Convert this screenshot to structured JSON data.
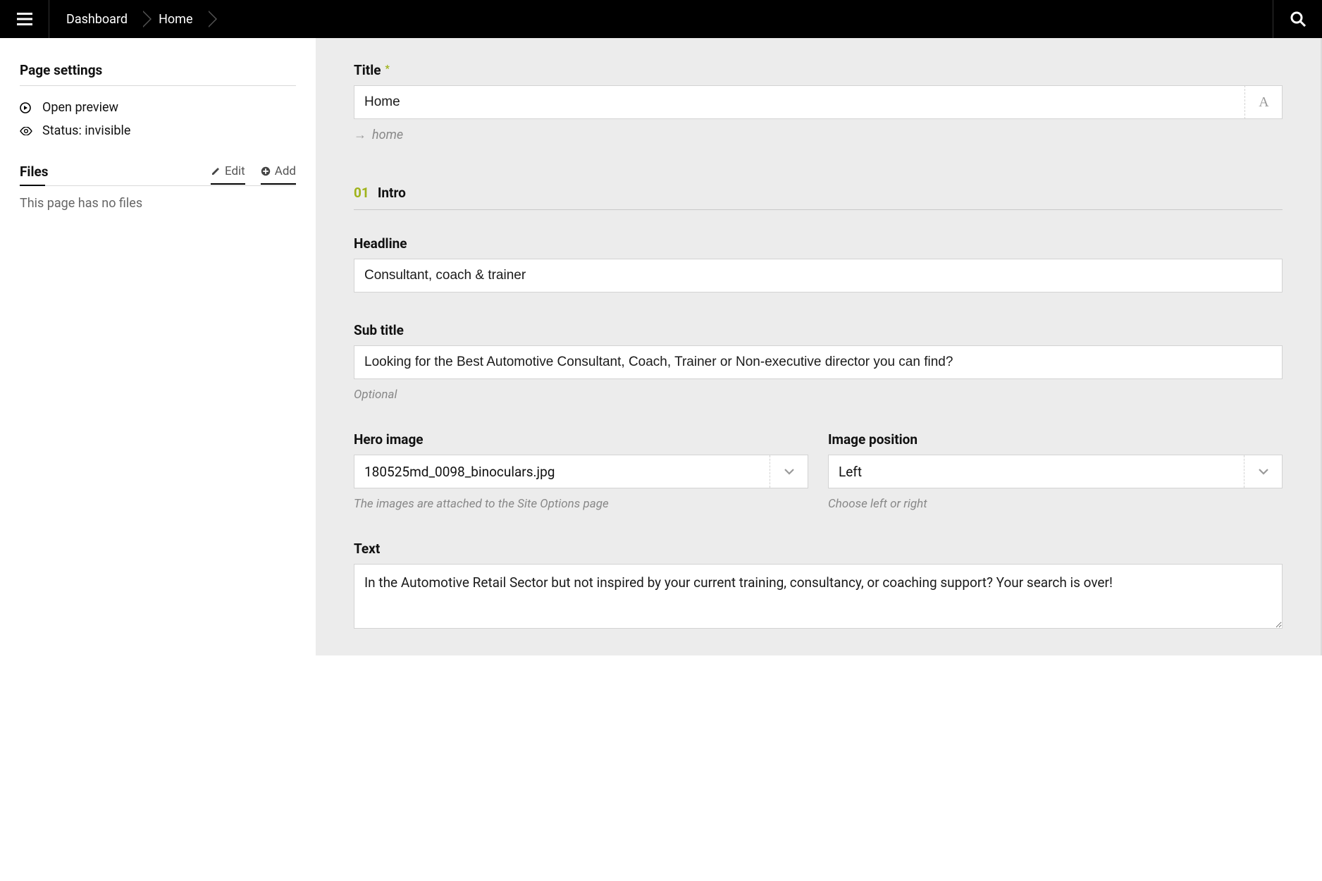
{
  "topbar": {
    "breadcrumbs": [
      "Dashboard",
      "Home"
    ]
  },
  "sidebar": {
    "page_settings_title": "Page settings",
    "open_preview": "Open preview",
    "status_label": "Status: invisible",
    "files_title": "Files",
    "edit_label": "Edit",
    "add_label": "Add",
    "no_files": "This page has no files"
  },
  "form": {
    "title_label": "Title",
    "title_value": "Home",
    "slug": "home",
    "section_num": "01",
    "section_name": "Intro",
    "headline_label": "Headline",
    "headline_value": "Consultant, coach & trainer",
    "subtitle_label": "Sub title",
    "subtitle_value": "Looking for the Best Automotive Consultant, Coach, Trainer or Non-executive director you can find?",
    "subtitle_help": "Optional",
    "hero_label": "Hero image",
    "hero_value": "180525md_0098_binoculars.jpg",
    "hero_help": "The images are attached to the Site Options page",
    "position_label": "Image position",
    "position_value": "Left",
    "position_help": "Choose left or right",
    "text_label": "Text",
    "text_value": "In the Automotive Retail Sector but not inspired by your current training, consultancy, or coaching support? Your search is over!"
  }
}
